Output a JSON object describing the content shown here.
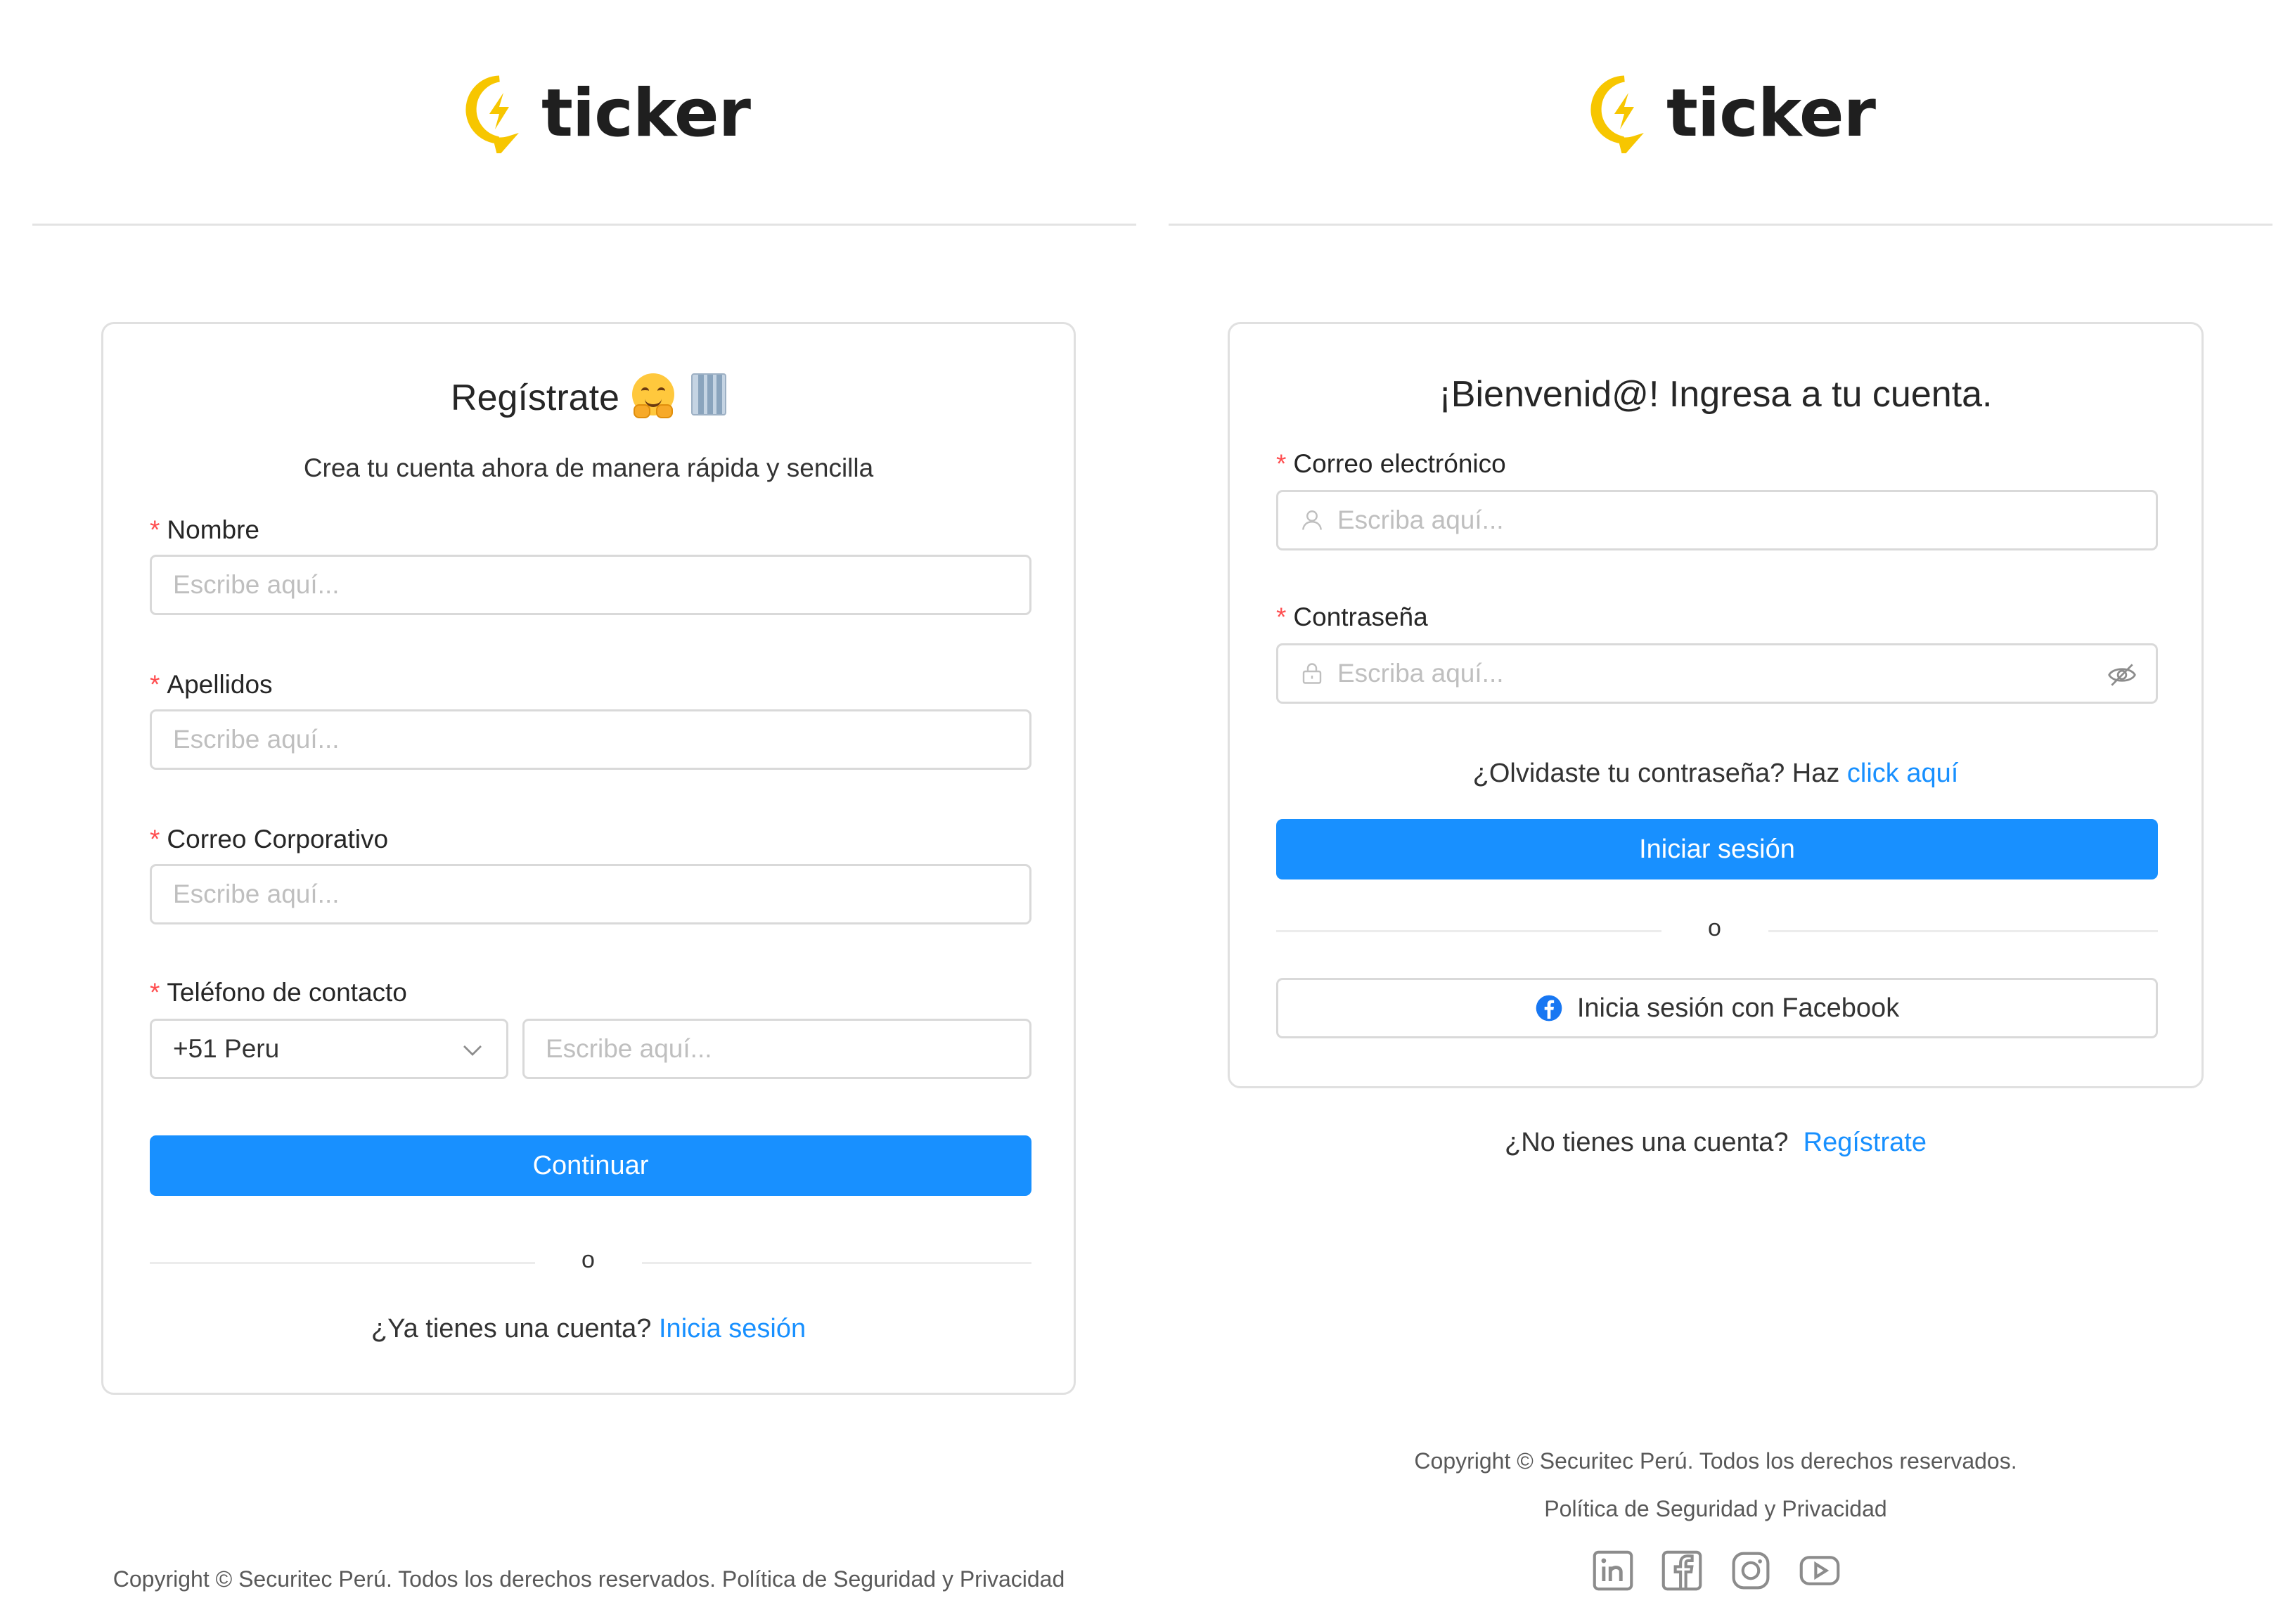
{
  "colors": {
    "primary": "#1890ff",
    "required": "#ff4d4f",
    "logo_yellow": "#f7c600"
  },
  "brand": {
    "name": "ticker"
  },
  "register": {
    "title": "Regístrate",
    "subtitle": "Crea tu cuenta ahora de manera rápida y sencilla",
    "fields": {
      "nombre": {
        "label": "Nombre",
        "placeholder": "Escribe aquí..."
      },
      "apellidos": {
        "label": "Apellidos",
        "placeholder": "Escribe aquí..."
      },
      "correo": {
        "label": "Correo Corporativo",
        "placeholder": "Escribe aquí..."
      },
      "telefono": {
        "label": "Teléfono de contacto",
        "country_code": "+51 Peru",
        "placeholder": "Escribe aquí..."
      }
    },
    "required_mark": "*",
    "continue_button": "Continuar",
    "or_text": "o",
    "have_account_text": "¿Ya tienes una cuenta?",
    "login_link": "Inicia sesión",
    "footer": "Copyright © Securitec Perú. Todos los derechos reservados. Política de Seguridad y Privacidad"
  },
  "login": {
    "title": "¡Bienvenid@! Ingresa a tu cuenta.",
    "fields": {
      "email": {
        "label": "Correo electrónico",
        "placeholder": "Escriba aquí..."
      },
      "password": {
        "label": "Contraseña",
        "placeholder": "Escriba aquí..."
      }
    },
    "required_mark": "*",
    "forgot_text": "¿Olvidaste tu contraseña? Haz",
    "forgot_link": "click aquí",
    "login_button": "Iniciar sesión",
    "or_text": "o",
    "facebook_button": "Inicia sesión con Facebook",
    "no_account_text": "¿No tienes una cuenta?",
    "register_link": "Regístrate",
    "footer_copyright": "Copyright © Securitec Perú. Todos los derechos reservados.",
    "footer_policy": "Política de Seguridad y Privacidad",
    "social_icons": [
      "linkedin-icon",
      "facebook-icon",
      "instagram-icon",
      "youtube-icon"
    ]
  }
}
